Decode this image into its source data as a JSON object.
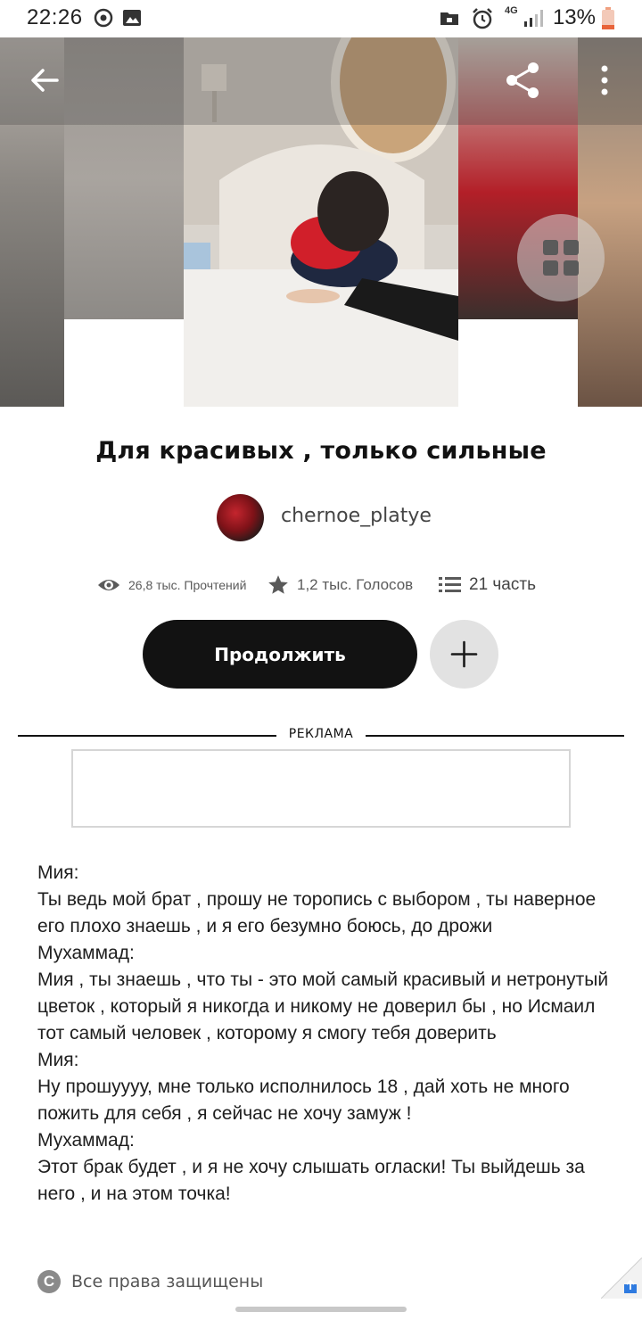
{
  "status_bar": {
    "time": "22:26",
    "network": "4G",
    "battery": "13%"
  },
  "toolbar": {
    "back_icon": "arrow-left-icon",
    "share_icon": "share-icon",
    "more_icon": "more-vertical-icon",
    "grid_icon": "grid-icon"
  },
  "story": {
    "title": "Для красивых , только сильные",
    "author": "chernoe_platye",
    "reads": "26,8 тыс. Прочтений",
    "votes": "1,2 тыс. Голосов",
    "parts": "21 часть",
    "continue_label": "Продолжить",
    "add_icon": "plus-icon"
  },
  "ad": {
    "label": "РЕКЛАМА"
  },
  "content": {
    "lines": [
      "Мия:",
      "Ты ведь мой брат , прошу не торопись с выбором , ты наверное его плохо знаешь   , и я его безумно  боюсь, до дрожи",
      "Мухаммад:",
      "Мия , ты знаешь , что ты - это мой самый красивый и нетронутый  цветок , который я никогда и никому не доверил бы , но Исмаил тот самый человек , которому я смогу тебя доверить",
      "Мия:",
      "Ну прошуууу, мне только исполнилось 18 , дай хоть не много пожить для себя , я сейчас не хочу замуж !",
      "Мухаммад:",
      "Этот брак будет , и я не хочу слышать огласки! Ты выйдешь за него , и на этом точка!"
    ]
  },
  "footer": {
    "copyright_symbol": "C",
    "copyright": "Все права защищены"
  },
  "colors": {
    "primary": "#121212",
    "secondary_button": "#e2e2e2",
    "muted_text": "#5a5a5a"
  }
}
